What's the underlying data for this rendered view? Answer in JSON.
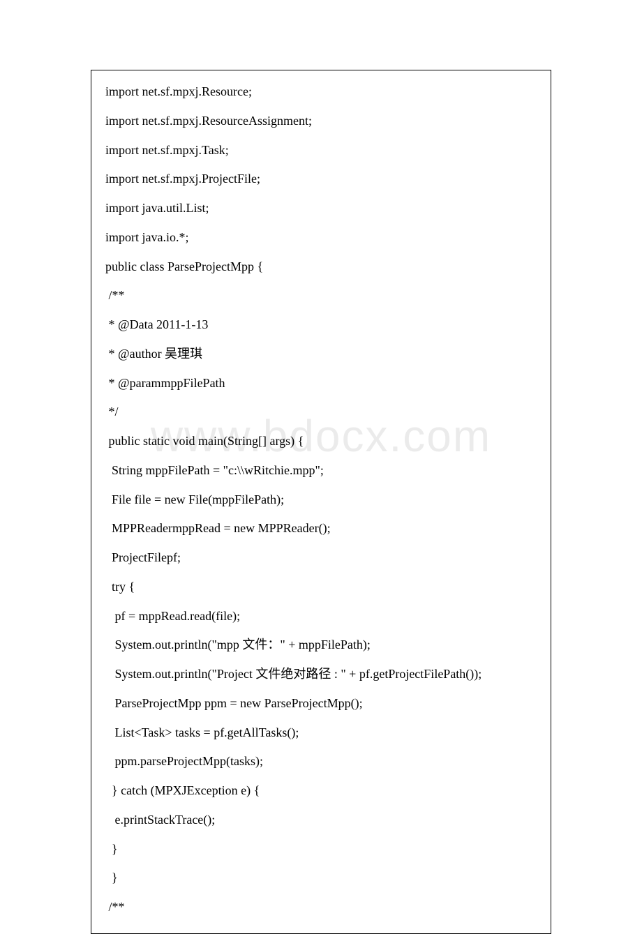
{
  "watermark": "www.bdocx.com",
  "code": {
    "lines": [
      "import net.sf.mpxj.Resource;",
      "import net.sf.mpxj.ResourceAssignment;",
      "import net.sf.mpxj.Task;",
      "import net.sf.mpxj.ProjectFile;",
      "import java.util.List;",
      "import java.io.*;",
      "public class ParseProjectMpp {",
      " /**",
      " * @Data 2011-1-13",
      " * @author 吴理琪",
      " * @parammppFilePath",
      " */",
      " public static void main(String[] args) {",
      "  String mppFilePath = \"c:\\\\wRitchie.mpp\";",
      "  File file = new File(mppFilePath);",
      "  MPPReadermppRead = new MPPReader();",
      "  ProjectFilepf;",
      "  try {",
      "   pf = mppRead.read(file);",
      "   System.out.println(\"mpp 文件：\" + mppFilePath);",
      "   System.out.println(\"Project 文件绝对路径 : \" + pf.getProjectFilePath());",
      "   ParseProjectMpp ppm = new ParseProjectMpp();",
      "   List<Task> tasks = pf.getAllTasks();",
      "   ppm.parseProjectMpp(tasks);",
      "  } catch (MPXJException e) {",
      "   e.printStackTrace();",
      "  }",
      "  }",
      " /**"
    ]
  }
}
